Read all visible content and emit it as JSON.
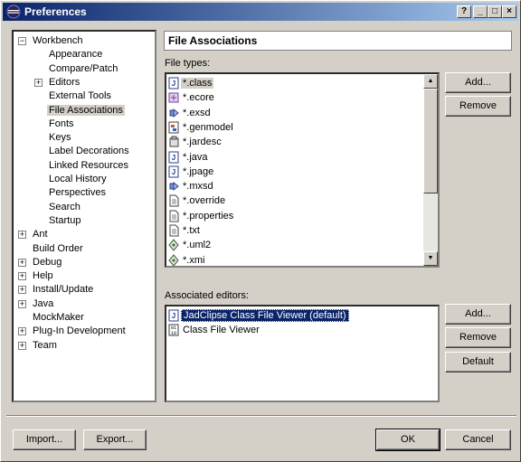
{
  "window": {
    "title": "Preferences",
    "controls": [
      "?",
      "_",
      "□",
      "×"
    ]
  },
  "tree": {
    "items": [
      {
        "label": "Workbench",
        "level": 0,
        "expander": "−"
      },
      {
        "label": "Appearance",
        "level": 1
      },
      {
        "label": "Compare/Patch",
        "level": 1
      },
      {
        "label": "Editors",
        "level": 1,
        "expander": "+"
      },
      {
        "label": "External Tools",
        "level": 1
      },
      {
        "label": "File Associations",
        "level": 1,
        "selected": true
      },
      {
        "label": "Fonts",
        "level": 1
      },
      {
        "label": "Keys",
        "level": 1
      },
      {
        "label": "Label Decorations",
        "level": 1
      },
      {
        "label": "Linked Resources",
        "level": 1
      },
      {
        "label": "Local History",
        "level": 1
      },
      {
        "label": "Perspectives",
        "level": 1
      },
      {
        "label": "Search",
        "level": 1
      },
      {
        "label": "Startup",
        "level": 1
      },
      {
        "label": "Ant",
        "level": 0,
        "expander": "+"
      },
      {
        "label": "Build Order",
        "level": 0
      },
      {
        "label": "Debug",
        "level": 0,
        "expander": "+"
      },
      {
        "label": "Help",
        "level": 0,
        "expander": "+"
      },
      {
        "label": "Install/Update",
        "level": 0,
        "expander": "+"
      },
      {
        "label": "Java",
        "level": 0,
        "expander": "+"
      },
      {
        "label": "MockMaker",
        "level": 0
      },
      {
        "label": "Plug-In Development",
        "level": 0,
        "expander": "+"
      },
      {
        "label": "Team",
        "level": 0,
        "expander": "+"
      }
    ]
  },
  "page": {
    "title": "File Associations",
    "file_types_label": "File types:",
    "file_types": [
      {
        "name": "*.class",
        "icon": "java-icon",
        "selected": true
      },
      {
        "name": "*.ecore",
        "icon": "ecore-icon"
      },
      {
        "name": "*.exsd",
        "icon": "plugin-icon"
      },
      {
        "name": "*.genmodel",
        "icon": "genmodel-icon"
      },
      {
        "name": "*.jardesc",
        "icon": "jar-icon"
      },
      {
        "name": "*.java",
        "icon": "java-icon"
      },
      {
        "name": "*.jpage",
        "icon": "java-icon"
      },
      {
        "name": "*.mxsd",
        "icon": "plugin-icon"
      },
      {
        "name": "*.override",
        "icon": "text-file-icon"
      },
      {
        "name": "*.properties",
        "icon": "text-file-icon"
      },
      {
        "name": "*.txt",
        "icon": "text-file-icon"
      },
      {
        "name": "*.uml2",
        "icon": "uml-icon"
      },
      {
        "name": "*.xmi",
        "icon": "uml-icon"
      }
    ],
    "add_label": "Add...",
    "remove_label": "Remove",
    "associated_editors_label": "Associated editors:",
    "editors": [
      {
        "name": "JadClipse Class File Viewer (default)",
        "icon": "java-icon",
        "selected": true
      },
      {
        "name": "Class File Viewer",
        "icon": "binary-icon"
      }
    ],
    "editor_add_label": "Add...",
    "editor_remove_label": "Remove",
    "default_label": "Default"
  },
  "footer": {
    "import_label": "Import...",
    "export_label": "Export...",
    "ok_label": "OK",
    "cancel_label": "Cancel"
  }
}
